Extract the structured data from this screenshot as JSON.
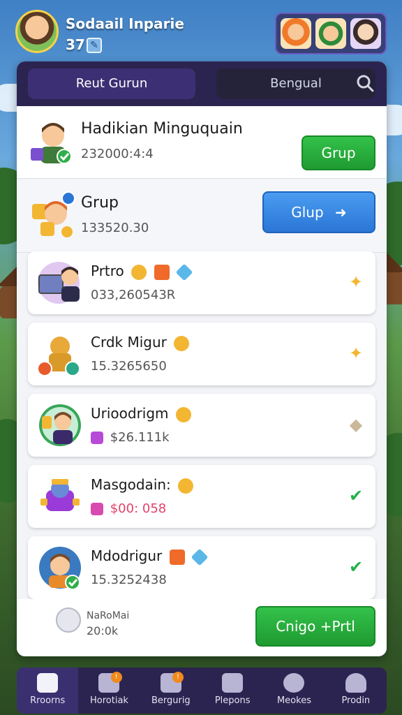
{
  "header": {
    "player_name": "Sodaail Inparie",
    "player_level": "37"
  },
  "tabs": {
    "active": "Reut Gurun",
    "inactive": "Bengual"
  },
  "featured": [
    {
      "title": "Hadikian Minguquain",
      "value": "232000:4:4",
      "button": "Grup"
    },
    {
      "title": "Grup",
      "value": "133520.30",
      "button": "Glup"
    }
  ],
  "cards": [
    {
      "title": "Prtro",
      "value": "033,260543R",
      "status": "star"
    },
    {
      "title": "Crdk Migur",
      "value": "15.3265650",
      "status": "star"
    },
    {
      "title": "Urioodrigm",
      "value": "$26.111k",
      "status": "pending"
    },
    {
      "title": "Masgodain:",
      "value": "$00: 058",
      "status": "check"
    },
    {
      "title": "Mdodrigur",
      "value": "15.3252438",
      "status": "check"
    }
  ],
  "footer": {
    "label": "NaRoMai",
    "value": "20:0k",
    "button": "Cnigo +Prtl"
  },
  "nav": [
    {
      "label": "Rroorns"
    },
    {
      "label": "Horotiak"
    },
    {
      "label": "Bergurig"
    },
    {
      "label": "Plepons"
    },
    {
      "label": "Meokes"
    },
    {
      "label": "Prodin"
    }
  ],
  "colors": {
    "accent_green": "#1f9a31",
    "accent_blue": "#2a76d6",
    "panel_dark": "#2c2450",
    "value_pink": "#e0436c"
  }
}
